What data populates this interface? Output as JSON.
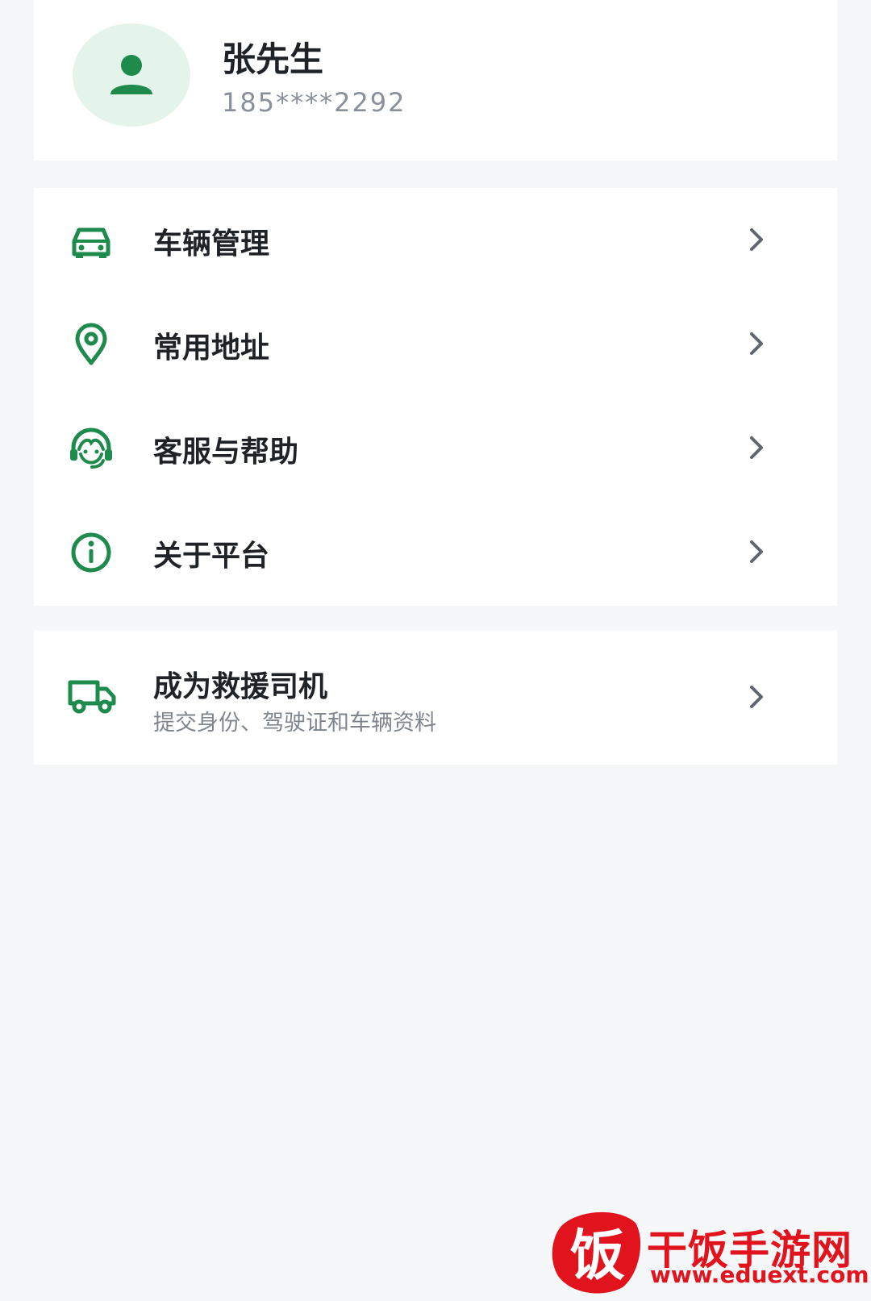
{
  "profile": {
    "avatar_icon": "user-icon",
    "name": "张先生",
    "phone": "185****2292"
  },
  "menu": {
    "items": [
      {
        "icon": "car-icon",
        "label": "车辆管理"
      },
      {
        "icon": "location-pin-icon",
        "label": "常用地址"
      },
      {
        "icon": "headset-icon",
        "label": "客服与帮助"
      },
      {
        "icon": "info-icon",
        "label": "关于平台"
      }
    ]
  },
  "driver": {
    "icon": "truck-icon",
    "title": "成为救援司机",
    "subtitle": "提交身份、驾驶证和车辆资料"
  },
  "watermark": {
    "logo_char": "饭",
    "site_name": "干饭手游网",
    "url": "www.eduext.com"
  },
  "colors": {
    "accent": "#1e8a4c",
    "avatar_bg": "#e5f4ea",
    "page_bg": "#f5f7f9",
    "text_primary": "#1f2328",
    "text_secondary": "#8a9099",
    "watermark_red": "#e1141e"
  }
}
